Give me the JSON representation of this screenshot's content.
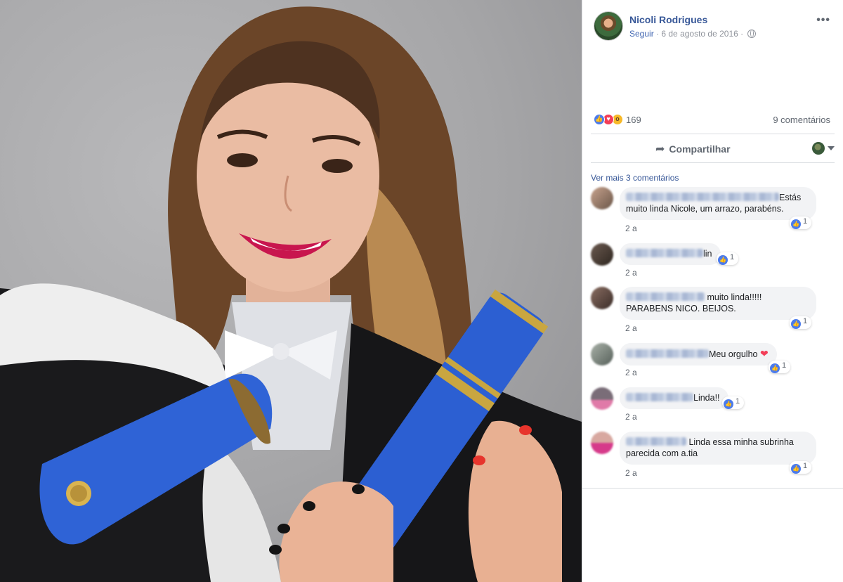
{
  "post": {
    "author": "Nicoli Rodrigues",
    "follow_label": "Seguir",
    "date": "6 de agosto de 2016",
    "more_label": "•••"
  },
  "reactions": {
    "count": "169",
    "comments_count": "9 comentários"
  },
  "actions": {
    "share_label": "Compartilhar"
  },
  "comments_section": {
    "more_label": "Ver mais 3 comentários",
    "items": [
      {
        "text": "Estás muito linda Nicole, um arrazo, parabéns.",
        "time": "2 a",
        "likes": "1"
      },
      {
        "text": "lin",
        "time": "2 a",
        "likes": "1"
      },
      {
        "text": "muito linda!!!!! PARABENS NICO. BEIJOS.",
        "time": "2 a",
        "likes": "1"
      },
      {
        "text": "Meu orgulho",
        "time": "2 a",
        "likes": "1"
      },
      {
        "text": "Linda!!",
        "time": "2 a",
        "likes": "1"
      },
      {
        "text": "Linda essa minha subrinha parecida com a.tia",
        "time": "2 a",
        "likes": "1"
      }
    ]
  },
  "colors": {
    "link": "#385898",
    "like_blue": "#4b7bec",
    "love_red": "#f33e58",
    "wow_yellow": "#f7b928",
    "bubble_bg": "#f2f3f5",
    "gown_blue": "#2f63d6"
  },
  "icons": [
    "globe-icon",
    "share-arrow-icon",
    "caret-down-icon",
    "like-icon",
    "love-icon",
    "wow-icon",
    "heart-icon"
  ]
}
